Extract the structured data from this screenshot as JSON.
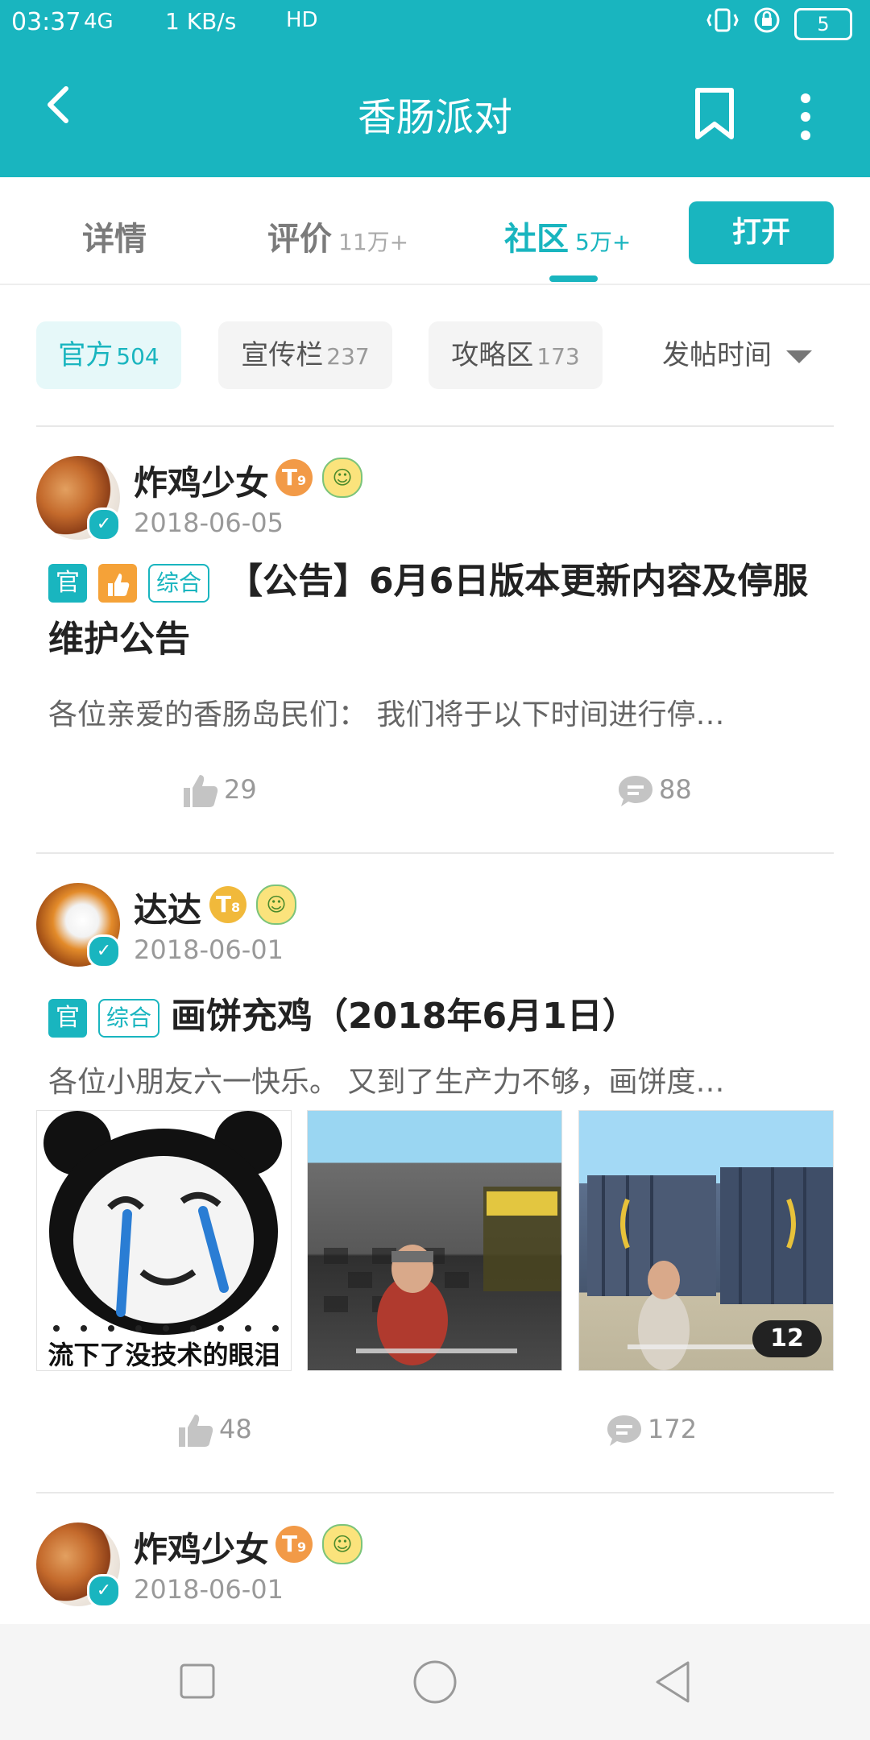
{
  "status_bar": {
    "time": "03:37",
    "signal": "4G",
    "net_speed": "1 KB/s",
    "hd": "HD",
    "battery": "5"
  },
  "header": {
    "title": "香肠派对",
    "back_icon": "back-arrow-icon",
    "bookmark_icon": "bookmark-icon",
    "menu_icon": "more-vertical-icon"
  },
  "tabs": [
    {
      "label": "详情",
      "count": ""
    },
    {
      "label": "评价",
      "count": "11万+"
    },
    {
      "label": "社区",
      "count": "5万+"
    }
  ],
  "open_button": "打开",
  "filters": [
    {
      "label": "官方",
      "count": "504"
    },
    {
      "label": "宣传栏",
      "count": "237"
    },
    {
      "label": "攻略区",
      "count": "173"
    }
  ],
  "sort_label": "发帖时间",
  "colors": {
    "accent": "#19b5bf",
    "hot": "#f5a238"
  },
  "posts": [
    {
      "author": "炸鸡少女",
      "level": "T",
      "level_sub": "9",
      "date": "2018-06-05",
      "tag_official": "官",
      "tag_category": "综合",
      "title": "【公告】6月6日版本更新内容及停服维护公告",
      "excerpt": "各位亲爱的香肠岛民们： 我们将于以下时间进行停…",
      "likes": "29",
      "comments": "88"
    },
    {
      "author": "达达",
      "level": "T",
      "level_sub": "8",
      "date": "2018-06-01",
      "tag_official": "官",
      "tag_category": "综合",
      "title": "画饼充鸡（2018年6月1日）",
      "excerpt": "各位小朋友六一快乐。 又到了生产力不够，画饼度…",
      "image_caption": "流下了没技术的眼泪",
      "image_count": "12",
      "likes": "48",
      "comments": "172"
    },
    {
      "author": "炸鸡少女",
      "level": "T",
      "level_sub": "9",
      "date": "2018-06-01"
    }
  ]
}
